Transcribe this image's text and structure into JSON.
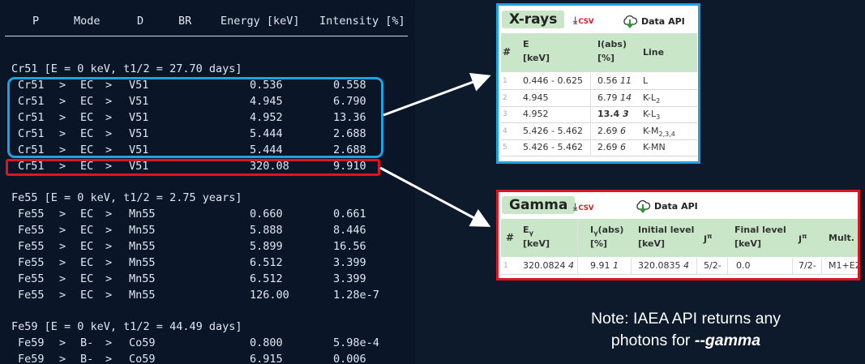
{
  "terminal": {
    "headers": [
      "P",
      "Mode",
      "D",
      "BR",
      "Energy [keV]",
      "Intensity [%]"
    ],
    "groups": [
      {
        "title": "Cr51 [E = 0 keV, t1/2 = 27.70 days]",
        "rows": [
          [
            "Cr51",
            ">",
            "EC",
            ">",
            "V51",
            "0.536",
            "0.558"
          ],
          [
            "Cr51",
            ">",
            "EC",
            ">",
            "V51",
            "4.945",
            "6.790"
          ],
          [
            "Cr51",
            ">",
            "EC",
            ">",
            "V51",
            "4.952",
            "13.36"
          ],
          [
            "Cr51",
            ">",
            "EC",
            ">",
            "V51",
            "5.444",
            "2.688"
          ],
          [
            "Cr51",
            ">",
            "EC",
            ">",
            "V51",
            "5.444",
            "2.688"
          ],
          [
            "Cr51",
            ">",
            "EC",
            ">",
            "V51",
            "320.08",
            "9.910"
          ]
        ]
      },
      {
        "title": "Fe55 [E = 0 keV, t1/2 = 2.75 years]",
        "rows": [
          [
            "Fe55",
            ">",
            "EC",
            ">",
            "Mn55",
            "0.660",
            "0.661"
          ],
          [
            "Fe55",
            ">",
            "EC",
            ">",
            "Mn55",
            "5.888",
            "8.446"
          ],
          [
            "Fe55",
            ">",
            "EC",
            ">",
            "Mn55",
            "5.899",
            "16.56"
          ],
          [
            "Fe55",
            ">",
            "EC",
            ">",
            "Mn55",
            "6.512",
            "3.399"
          ],
          [
            "Fe55",
            ">",
            "EC",
            ">",
            "Mn55",
            "6.512",
            "3.399"
          ],
          [
            "Fe55",
            ">",
            "EC",
            ">",
            "Mn55",
            "126.00",
            "1.28e-7"
          ]
        ]
      },
      {
        "title": "Fe59 [E = 0 keV, t1/2 = 44.49 days]",
        "rows": [
          [
            "Fe59",
            ">",
            "B-",
            ">",
            "Co59",
            "0.800",
            "5.98e-4"
          ],
          [
            "Fe59",
            ">",
            "B-",
            ">",
            "Co59",
            "6.915",
            "0.006"
          ]
        ]
      }
    ]
  },
  "xrays": {
    "title": "X-rays",
    "csv_label": "CSV",
    "api_label": "Data API",
    "headers": {
      "idx": "#",
      "e1": "E",
      "e2": "[keV]",
      "i1": "I(abs)",
      "i2": "[%]",
      "line": "Line"
    },
    "rows": [
      {
        "idx": "1",
        "e": "0.446 - 0.625",
        "iv": "0.56",
        "iu": "11",
        "line": "L",
        "sub": "",
        "bold": false
      },
      {
        "idx": "2",
        "e": "4.945",
        "iv": "6.79",
        "iu": "14",
        "line": "K-L",
        "sub": "2",
        "bold": false
      },
      {
        "idx": "3",
        "e": "4.952",
        "iv": "13.4",
        "iu": "3",
        "line": "K-L",
        "sub": "3",
        "bold": true
      },
      {
        "idx": "4",
        "e": "5.426 - 5.462",
        "iv": "2.69",
        "iu": "6",
        "line": "K-M",
        "sub": "2,3,4",
        "bold": false
      },
      {
        "idx": "5",
        "e": "5.426 - 5.462",
        "iv": "2.69",
        "iu": "6",
        "line": "K-MN",
        "sub": "",
        "bold": false
      }
    ]
  },
  "gamma": {
    "title": "Gamma",
    "csv_label": "CSV",
    "api_label": "Data API",
    "headers": {
      "idx": "#",
      "e1": "E",
      "e1sub": "γ",
      "e2": "[keV]",
      "i1": "I",
      "i1sub": "γ",
      "i1b": "(abs)",
      "i2": "[%]",
      "init1": "Initial level",
      "init2": "[keV]",
      "j": "J",
      "jsup": "π",
      "fin1": "Final level",
      "fin2": "[keV]",
      "j2": "J",
      "j2sup": "π",
      "mult": "Mult."
    },
    "row": {
      "idx": "1",
      "e": "320.0824",
      "eu": "4",
      "i": "9.91",
      "iu": "1",
      "init": "320.0835",
      "initu": "4",
      "jp": "5/2-",
      "fin": "0.0",
      "jf": "7/2-",
      "mult": "M1+E2"
    }
  },
  "note": {
    "line1": "Note: IAEA API returns any",
    "line2a": "photons for ",
    "line2b": "--gamma"
  },
  "colors": {
    "blue": "#1fa3e0",
    "red": "#e0141e",
    "header_green": "#c9e6c9"
  }
}
